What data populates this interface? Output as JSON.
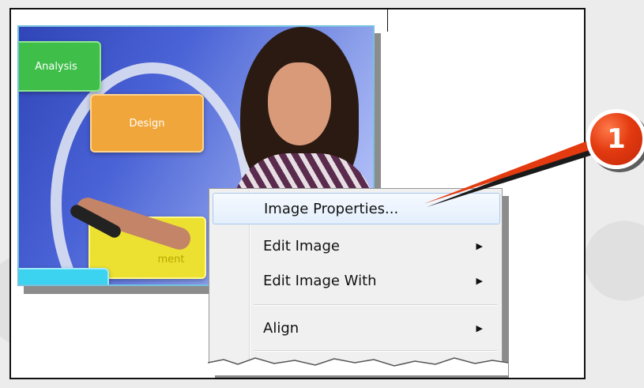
{
  "slide": {
    "boxes": {
      "analysis": "Analysis",
      "design": "Design",
      "development": "ment"
    }
  },
  "context_menu": {
    "items": [
      {
        "label": "Image Properties...",
        "has_submenu": false,
        "highlighted": true
      },
      {
        "label": "Edit Image",
        "has_submenu": true,
        "highlighted": false
      },
      {
        "label": "Edit Image With",
        "has_submenu": true,
        "highlighted": false
      },
      {
        "label": "Align",
        "has_submenu": true,
        "highlighted": false
      }
    ],
    "submenu_arrow": "▶"
  },
  "callout": {
    "number": "1",
    "color": "#e33a10"
  }
}
